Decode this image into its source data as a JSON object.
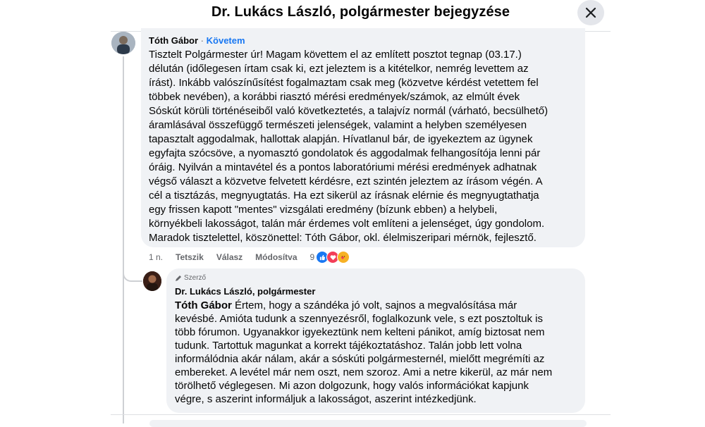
{
  "header": {
    "title": "Dr. Lukács László, polgármester bejegyzése"
  },
  "close_icon": "close-icon",
  "comment1": {
    "author": "Tóth Gábor",
    "separator": "·",
    "follow_label": "Követem",
    "text": "Tisztelt Polgármester úr! Magam követtem el az említett posztot tegnap (03.17.)\ndélután (időlegesen írtam csak ki, ezt jeleztem is a kitételkor, nemrég levettem az\nírást). Inkább valószínűsítést fogalmaztam csak meg (közvetve kérdést vetettem fel\ntöbbek nevében), a korábbi riasztó mérési eredmények/számok, az elmúlt évek\nSóskút körüli történéseiből való következtetés, a talajvíz normál (várható, becsülhető)\náramlásával összefüggő természeti jelenségek, valamint a helyben személyesen\ntapasztalt aggodalmak, hallottak alapján. Hívatlanul bár, de igyekeztem az ügynek\negyfajta szócsöve, a nyomasztó gondolatok és aggodalmak felhangosítója lenni pár\nóráig. Nyilván a mintavétel és a pontos laboratóriumi mérési eredmények adhatnak\nvégső választ a közvetve felvetett kérdésre, ezt szintén jeleztem az írásom végén. A\ncél a tisztázás, megnyugtatás. Ha ezt sikerül az írásnak elérnie és megnyugtathatja\negy frissen kapott \"mentes\" vizsgálati eredmény (bízunk ebben) a helybeli,\nkörnyékbeli lakosságot, talán már érdemes volt említeni a jelenséget, úgy gondolom.\nMaradok tisztelettel, köszönettel: Tóth Gábor, okl. élelmiszeripari mérnök, fejlesztő.",
    "time": "1 n.",
    "like_label": "Tetszik",
    "reply_label": "Válasz",
    "edited_label": "Módosítva",
    "reaction_count": "9"
  },
  "comment2": {
    "badge": "Szerző",
    "author": "Dr. Lukács László, polgármester",
    "mention": "Tóth Gábor",
    "text": " Értem, hogy a szándéka jó volt, sajnos a megvalósítása már\nkevésbé. Amióta tudunk a szennyezésről, foglalkozunk vele, s ezt posztoltuk is\ntöbb fórumon. Ugyanakkor igyekeztünk nem kelteni pánikot, amíg biztosat nem\ntudunk. Tartottuk magunkat a korrekt tájékoztatáshoz. Talán jobb lett volna\ninformálódnia akár nálam, akár a sóskúti polgármesternél, mielőtt megrémíti az\nembereket. A levétel már nem oszt, nem szoroz. Ami a netre kikerül, az már nem\ntörölhető véglegesen. Mi azon dolgozunk, hogy valós információkat kapjunk\nvégre, s aszerint informáljuk a lakosságot, aszerint intézkedjünk."
  }
}
